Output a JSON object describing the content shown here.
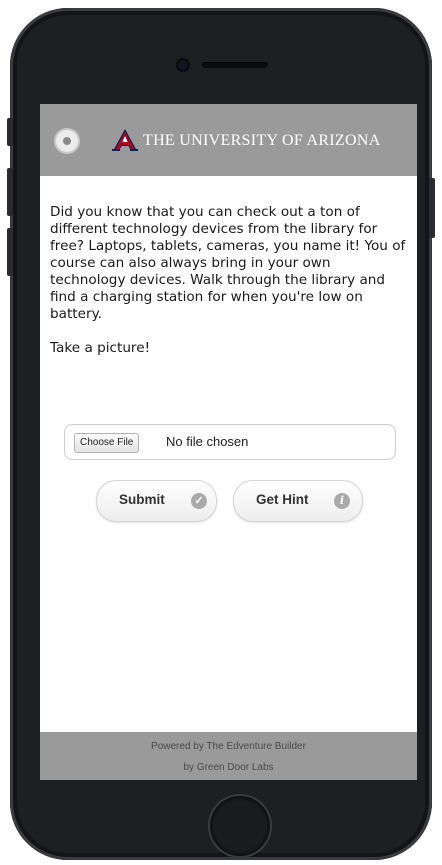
{
  "header": {
    "title": "THE UNIVERSITY OF ARIZONA",
    "menu_icon": "menu-circle-icon",
    "logo_icon": "ua-block-a-logo",
    "accent_color": "#9a9a9a",
    "brand_color": "#ab0520",
    "brand_navy": "#0c234b"
  },
  "content": {
    "body_text": "Did you know that you can check out a ton of different technology devices from the library for free? Laptops, tablets, cameras, you name it! You of course can also always bring in your own technology devices. Walk through the library and find a charging station for when you're low on battery.",
    "prompt": "Take a picture!"
  },
  "file_input": {
    "button_label": "Choose File",
    "status": "No file chosen"
  },
  "actions": {
    "submit_label": "Submit",
    "submit_icon": "check-circle-icon",
    "hint_label": "Get Hint",
    "hint_icon": "info-circle-icon"
  },
  "footer": {
    "line1": "Powered by The Edventure Builder",
    "line2": "by Green Door Labs"
  }
}
